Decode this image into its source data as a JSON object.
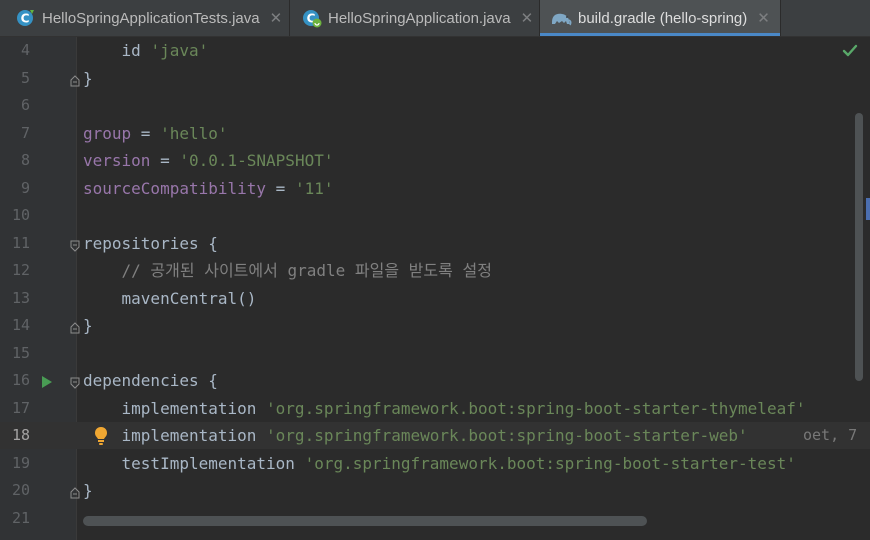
{
  "tabs": [
    {
      "label": "HelloSpringApplicationTests.java",
      "icon": "java-test-class-icon",
      "active": false
    },
    {
      "label": "HelloSpringApplication.java",
      "icon": "spring-boot-class-icon",
      "active": false
    },
    {
      "label": "build.gradle (hello-spring)",
      "icon": "gradle-elephant-icon",
      "active": true
    }
  ],
  "editor": {
    "status_icon": "inspection-ok-check-icon",
    "lines": [
      {
        "num": "4",
        "indent": "    ",
        "tokens": [
          {
            "t": "id ",
            "c": "kw"
          },
          {
            "t": "'java'",
            "c": "str"
          }
        ]
      },
      {
        "num": "5",
        "tokens": [
          {
            "t": "}",
            "c": "kw"
          }
        ]
      },
      {
        "num": "6",
        "tokens": []
      },
      {
        "num": "7",
        "tokens": [
          {
            "t": "group",
            "c": "prop"
          },
          {
            "t": " = ",
            "c": "kw"
          },
          {
            "t": "'hello'",
            "c": "str"
          }
        ]
      },
      {
        "num": "8",
        "tokens": [
          {
            "t": "version",
            "c": "prop"
          },
          {
            "t": " = ",
            "c": "kw"
          },
          {
            "t": "'0.0.1-SNAPSHOT'",
            "c": "str"
          }
        ]
      },
      {
        "num": "9",
        "tokens": [
          {
            "t": "sourceCompatibility",
            "c": "prop"
          },
          {
            "t": " = ",
            "c": "kw"
          },
          {
            "t": "'11'",
            "c": "str"
          }
        ]
      },
      {
        "num": "10",
        "tokens": []
      },
      {
        "num": "11",
        "tokens": [
          {
            "t": "repositories {",
            "c": "kw"
          }
        ]
      },
      {
        "num": "12",
        "indent": "    ",
        "tokens": [
          {
            "t": "// 공개된 사이트에서 gradle 파일을 받도록 설정",
            "c": "cmt"
          }
        ]
      },
      {
        "num": "13",
        "indent": "    ",
        "tokens": [
          {
            "t": "mavenCentral()",
            "c": "kw"
          }
        ]
      },
      {
        "num": "14",
        "tokens": [
          {
            "t": "}",
            "c": "kw"
          }
        ]
      },
      {
        "num": "15",
        "tokens": []
      },
      {
        "num": "16",
        "tokens": [
          {
            "t": "dependencies {",
            "c": "kw"
          }
        ]
      },
      {
        "num": "17",
        "indent": "    ",
        "tokens": [
          {
            "t": "implementation ",
            "c": "kw"
          },
          {
            "t": "'org.springframework.boot:spring-boot-starter-thymeleaf'",
            "c": "str"
          }
        ]
      },
      {
        "num": "18",
        "indent": "    ",
        "tokens": [
          {
            "t": "implementation ",
            "c": "kw"
          },
          {
            "t": "'org.springframework.boot:spring-boot-starter-web'",
            "c": "str"
          }
        ],
        "hint": "oet, 7"
      },
      {
        "num": "19",
        "indent": "    ",
        "tokens": [
          {
            "t": "testImplementation ",
            "c": "kw"
          },
          {
            "t": "'org.springframework.boot:spring-boot-starter-test'",
            "c": "str"
          }
        ]
      },
      {
        "num": "20",
        "tokens": [
          {
            "t": "}",
            "c": "kw"
          }
        ]
      },
      {
        "num": "21",
        "tokens": []
      }
    ]
  }
}
